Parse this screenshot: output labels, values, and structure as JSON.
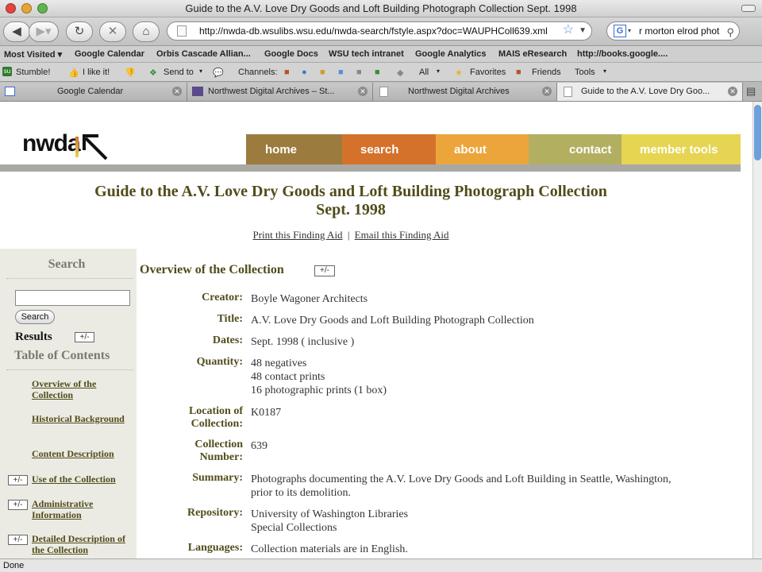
{
  "window": {
    "title": "Guide to the A.V. Love Dry Goods and Loft Building Photograph Collection Sept. 1998"
  },
  "navbar": {
    "url": "http://nwda-db.wsulibs.wsu.edu/nwda-search/fstyle.aspx?doc=WAUPHColl639.xml",
    "search_value": "r morton elrod phot"
  },
  "bookmarks": [
    "Most Visited ▾",
    "Google Calendar",
    "Orbis Cascade Allian...",
    "Google Docs",
    "WSU tech intranet",
    "Google Analytics",
    "MAIS eResearch",
    "http://books.google...."
  ],
  "stumble": {
    "stumble": "Stumble!",
    "like": "I like it!",
    "send": "Send to",
    "channels": "Channels:",
    "all": "All",
    "favorites": "Favorites",
    "friends": "Friends",
    "tools": "Tools"
  },
  "tabs": [
    "Google Calendar",
    "Northwest Digital Archives – St...",
    "Northwest Digital Archives",
    "Guide to the A.V. Love Dry Goo..."
  ],
  "site": {
    "logo": "nwda",
    "nav": [
      "home",
      "search",
      "about",
      "contact us",
      "member tools"
    ],
    "colors": {
      "home": "#9c7b3e",
      "search": "#d4722c",
      "about": "#eca53b",
      "contact": "#b3af61",
      "member": "#e6d552"
    }
  },
  "page": {
    "title_line1": "Guide to the A.V. Love Dry Goods and Loft Building Photograph Collection",
    "title_line2": "Sept. 1998",
    "print_link": "Print this Finding Aid",
    "separator": "|",
    "email_link": "Email this Finding Aid"
  },
  "sidebar": {
    "search_heading": "Search",
    "search_button": "Search",
    "results_label": "Results",
    "toggle": "+/-",
    "toc_heading": "Table of Contents",
    "toc": [
      "Overview of the Collection",
      "Historical Background",
      "Content Description",
      "Use of the Collection",
      "Administrative Information",
      "Detailed Description of the Collection"
    ]
  },
  "overview": {
    "heading": "Overview of the Collection",
    "toggle": "+/-",
    "fields": [
      {
        "label": "Creator:",
        "value": "Boyle Wagoner Architects"
      },
      {
        "label": "Title:",
        "value": "A.V. Love Dry Goods and Loft Building Photograph Collection"
      },
      {
        "label": "Dates:",
        "value": "Sept. 1998 ( inclusive )"
      },
      {
        "label": "Quantity:",
        "value_lines": [
          "48 negatives",
          "48 contact prints",
          "16 photographic prints (1 box)"
        ]
      },
      {
        "label_lines": [
          "Location of",
          "Collection:"
        ],
        "value": "K0187"
      },
      {
        "label_lines": [
          "Collection",
          "Number:"
        ],
        "value": "639"
      },
      {
        "label": "Summary:",
        "value_lines": [
          "Photographs documenting the A.V. Love Dry Goods and Loft Building in Seattle, Washington,",
          "prior to its demolition."
        ]
      },
      {
        "label": "Repository:",
        "value_lines": [
          "University of Washington Libraries",
          "Special Collections"
        ]
      },
      {
        "label": "Languages:",
        "value": "Collection materials are in English."
      }
    ]
  },
  "status": {
    "text": "Done"
  }
}
